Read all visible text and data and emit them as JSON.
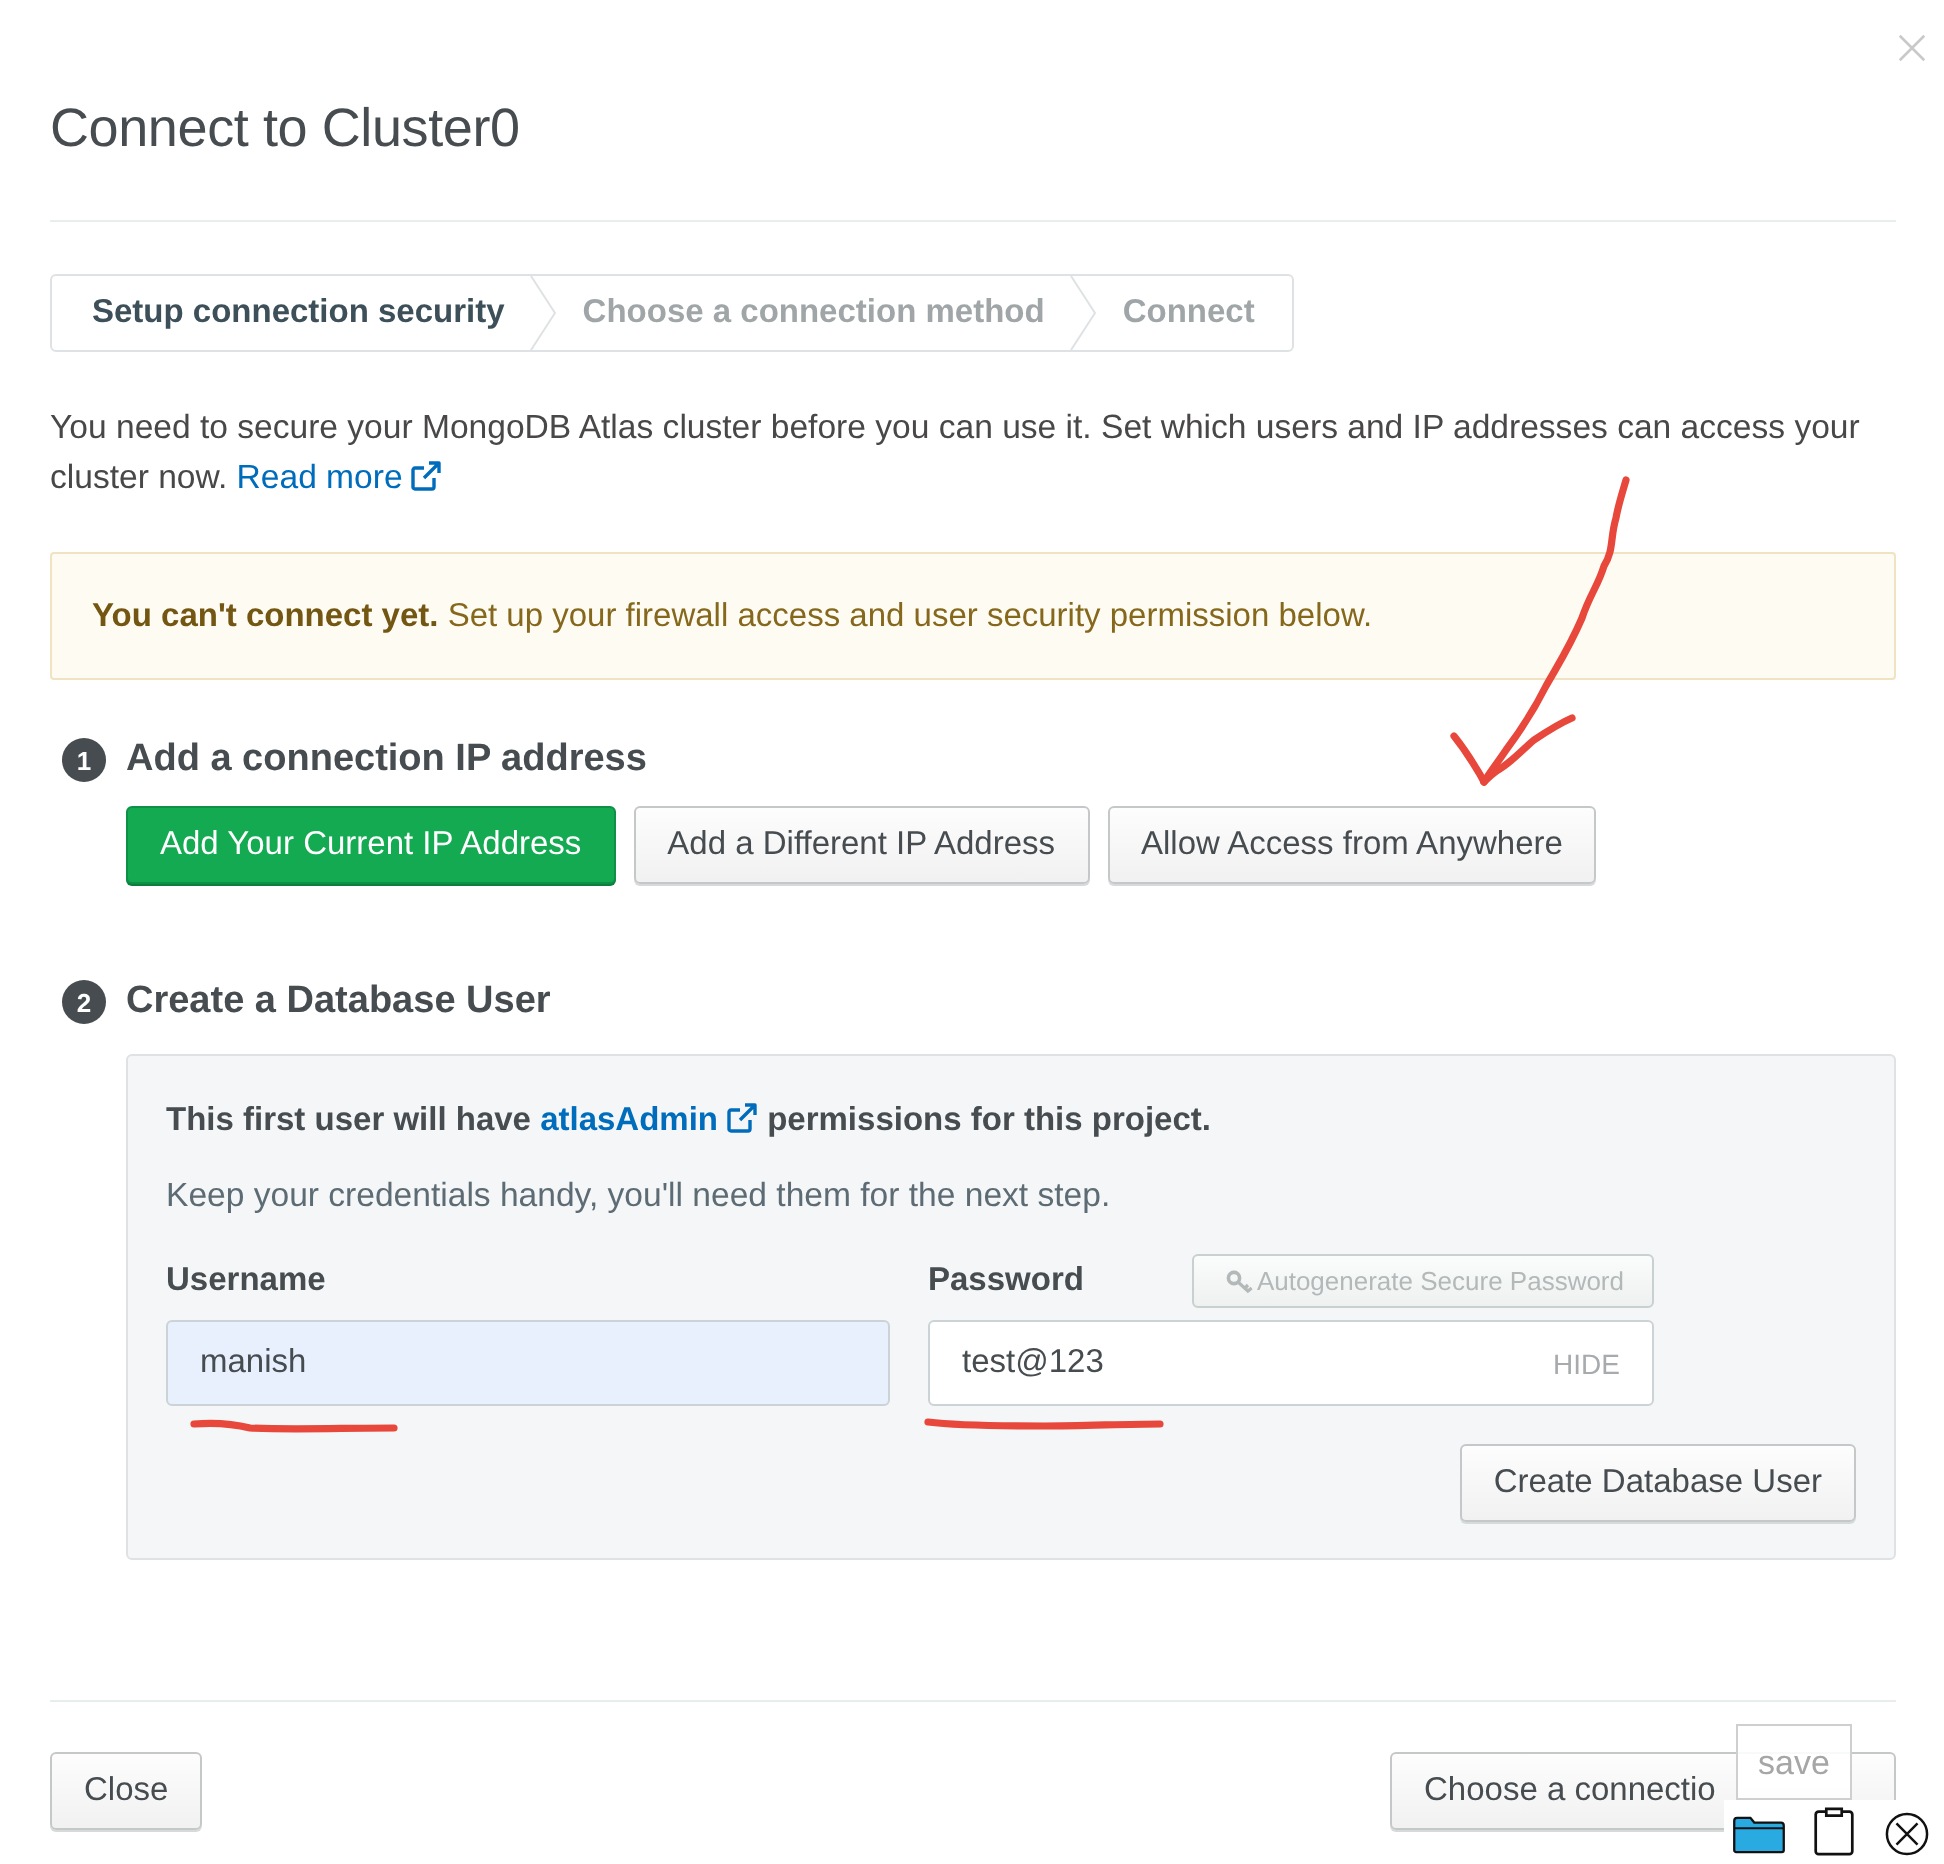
{
  "window": {
    "title": "Connect to Cluster0"
  },
  "steps": [
    {
      "label": "Setup connection security",
      "selected": true
    },
    {
      "label": "Choose a connection method",
      "selected": false
    },
    {
      "label": "Connect",
      "selected": false
    }
  ],
  "intro": {
    "text": "You need to secure your MongoDB Atlas cluster before you can use it. Set which users and IP addresses can access your cluster now.",
    "link": "Read more"
  },
  "alert": {
    "text": "**You can't connect yet.** Set up your firewall access and user security permission below."
  },
  "ip_section": {
    "number": "1",
    "title": "Add a connection IP address",
    "buttons": [
      {
        "label": "Add Your Current IP Address",
        "kind": "primary",
        "annotated": false
      },
      {
        "label": "Add a Different IP Address",
        "kind": "default",
        "annotated": false
      },
      {
        "label": "Allow Access from Anywhere",
        "kind": "default",
        "annotated": true
      }
    ]
  },
  "user_section": {
    "number": "2",
    "title": "Create a Database User",
    "notice": {
      "before": "This first user will have",
      "link": "atlasAdmin",
      "after": "permissions for this project."
    },
    "hint": "Keep your credentials handy, you'll need them for the next step.",
    "username": {
      "label": "Username",
      "value": "manish",
      "autofilled": true,
      "annotated": true
    },
    "password": {
      "label": "Password",
      "value": "test@123",
      "toggle": "HIDE",
      "annotated": true
    },
    "autogenerate": {
      "label": "Autogenerate Secure Password",
      "disabled": true
    },
    "create_button": "Create Database User"
  },
  "footer": {
    "close": "Close",
    "next": "Choose a connectio"
  },
  "overlay": {
    "label": "save"
  }
}
